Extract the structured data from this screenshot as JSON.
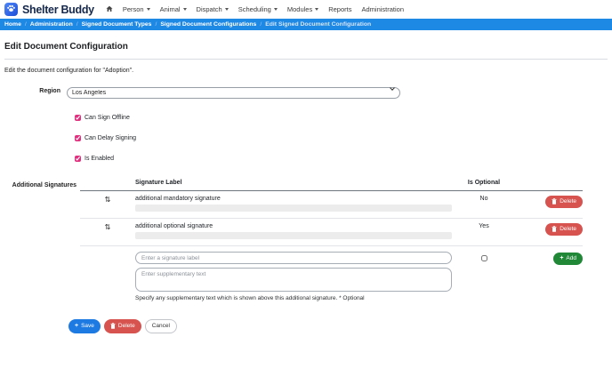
{
  "brand": {
    "name": "Shelter Buddy"
  },
  "nav": {
    "items": [
      {
        "label": "Person",
        "has_dropdown": true
      },
      {
        "label": "Animal",
        "has_dropdown": true
      },
      {
        "label": "Dispatch",
        "has_dropdown": true
      },
      {
        "label": "Scheduling",
        "has_dropdown": true
      },
      {
        "label": "Modules",
        "has_dropdown": true
      },
      {
        "label": "Reports",
        "has_dropdown": false
      },
      {
        "label": "Administration",
        "has_dropdown": false
      }
    ]
  },
  "breadcrumb": {
    "separator": "/",
    "items": [
      "Home",
      "Administration",
      "Signed Document Types",
      "Signed Document Configurations",
      "Edit Signed Document Configuration"
    ]
  },
  "page": {
    "title": "Edit Document Configuration",
    "intro": "Edit the document configuration for \"Adoption\"."
  },
  "form": {
    "region": {
      "label": "Region",
      "selected": "Los Angeles"
    },
    "checkboxes": [
      {
        "label": "Can Sign Offline",
        "checked": "checked"
      },
      {
        "label": "Can Delay Signing",
        "checked": "checked"
      },
      {
        "label": "Is Enabled",
        "checked": "checked"
      }
    ],
    "signatures": {
      "caption": "Additional Signatures",
      "columns": {
        "label": "Signature Label",
        "optional": "Is Optional"
      },
      "rows": [
        {
          "label": "additional mandatory signature",
          "is_optional": "No"
        },
        {
          "label": "additional optional signature",
          "is_optional": "Yes"
        }
      ],
      "delete_label": "Delete",
      "add": {
        "label_placeholder": "Enter a signature label",
        "supplementary_placeholder": "Enter supplementary text",
        "help": "Specify any supplementary text which is shown above this additional signature. * Optional",
        "add_label": "Add"
      }
    },
    "actions": {
      "save": "Save",
      "delete": "Delete",
      "cancel": "Cancel"
    }
  },
  "icons": {
    "reorder": "⇅",
    "plus": "+"
  },
  "colors": {
    "breadcrumb_bg": "#1e88e5",
    "checkbox_accent": "#e0317f",
    "delete_red": "#d6534f",
    "add_green": "#218838",
    "save_blue": "#1d7ae2",
    "brand_navy": "#15284b"
  }
}
